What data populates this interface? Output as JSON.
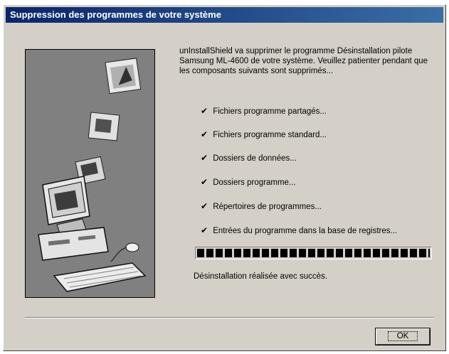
{
  "window": {
    "title": "Suppression des programmes de votre système"
  },
  "illustration": {
    "icon": "computer-uninstall-illustration"
  },
  "intro_text": "unInstallShield va supprimer le programme Désinstallation pilote Samsung ML-4600 de votre système. Veuillez patienter pendant que les composants suivants sont supprimés...",
  "steps": [
    {
      "label": "Fichiers programme partagés...",
      "checked": true
    },
    {
      "label": "Fichiers programme standard...",
      "checked": true
    },
    {
      "label": "Dossiers de données...",
      "checked": true
    },
    {
      "label": "Dossiers programme...",
      "checked": true
    },
    {
      "label": "Répertoires de programmes...",
      "checked": true
    },
    {
      "label": "Entrées du programme dans la base de registres...",
      "checked": true
    }
  ],
  "check_glyph": "✔",
  "progress": {
    "percent": 100
  },
  "status_text": "Désinstallation réalisée avec succès.",
  "buttons": {
    "ok_label": "OK"
  },
  "colors": {
    "titlebar_start": "#0a246a",
    "titlebar_end": "#3a6ea5",
    "dialog_bg": "#d4d0c8"
  }
}
